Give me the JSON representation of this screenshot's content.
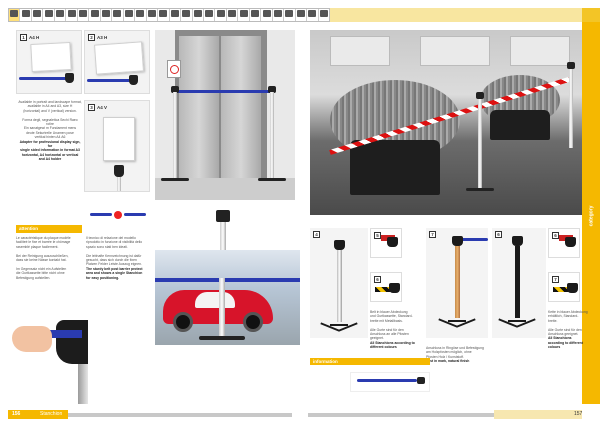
{
  "icon_strip": {
    "cells": [
      "",
      "",
      "",
      "",
      "",
      "",
      "",
      "",
      "",
      "",
      "",
      "",
      "",
      "",
      "",
      "",
      "",
      "",
      "",
      "",
      "",
      "",
      "",
      "",
      "",
      "",
      "",
      ""
    ],
    "active_index": 0
  },
  "side_tab": {
    "label": "category"
  },
  "products": [
    {
      "number": "1",
      "code": "A4 H"
    },
    {
      "number": "2",
      "code": "A3 H"
    },
    {
      "number": "3",
      "code": "A4 V"
    }
  ],
  "left_text": {
    "lines": [
      "Available in portrait and landscape format,",
      "available in A4 and A3, size H",
      "(horizontal) and V (vertical) version.",
      "",
      "Forma degli, segnaletica Sechi Raeo rotire",
      "Ein sanatgewi m Fundament mens",
      "deute Sekurtrelle Unamen pose",
      "vertikal hinten A4 A6"
    ],
    "bold_lines": [
      "Adapter for professional display sign, for",
      "single sided information in format A3",
      "horizontal, A4 horizontal or vertical",
      "and A4 holder"
    ]
  },
  "attention": {
    "label": "attention",
    "lines": [
      "Le caractéristique du plaque modèle",
      "faciliteé le fixe et barrée le chômage",
      "rasemblé plaque facilement.",
      "",
      "Bei der Reinigung auszuschließen,",
      "dass sie keine Nässe kontakt hat.",
      "",
      "Im Gegensatz nicht ein Aufstellen",
      "die Gurtkassette bitte nicht ohne",
      "Befestigung aufstellen."
    ]
  },
  "middle_text": {
    "lines": [
      "Il tecnico di relazione del modello",
      "riprodotto in funzione di visibilità dello",
      "spazio sono stati ben ideati.",
      "",
      "Die lebhafte Kennzeichnung ist dafür",
      "gesucht, dass sich durch die fixen",
      "Platzen Felder Leiste Auszug eignen."
    ],
    "bold_lines": [
      "The sturdy belt post barrier protect",
      "area and shows a single Stanchion",
      "for easy positioning."
    ]
  },
  "variants": [
    {
      "letter": "4",
      "text_lines": [
        "Abkündigungsregel bei stanchionen",
        "feststehen mit bleibelem",
        "Bodenplatten."
      ],
      "bold": "Stahl"
    },
    {
      "letter": "5",
      "text_lines": [],
      "bold": ""
    },
    {
      "letter": "6",
      "text_lines": [
        "Belt in blauer Abdeckung erhältlich",
        "neben dem Modell",
        "und Gurtkassette möglich."
      ],
      "bold": "Ohne Ersatzteile"
    },
    {
      "letter": "7",
      "text_lines": [],
      "bold": ""
    }
  ],
  "variant_captions": {
    "left": [
      "Belt in blauer Abdeckung",
      "und Gurtkassette, Standard-",
      "breite mit Metallbasis.",
      "",
      "Alle Gurte sind für den",
      "Anschluss an alle Pfosten",
      "geeignet."
    ],
    "left_bold": "All Stanchions according to different colours",
    "middle": [
      "Anschluss in Ringöse und Befestigung",
      "am Holzpfosten möglich, ohne",
      "Pfosten Holz / Kunststoff."
    ],
    "middle_bold": "post in mark, natural finish",
    "right": [
      "Kette in blauer Abdeckung",
      "erhältlich, Standard-",
      "breite.",
      "",
      "Alle Gurte sind für den",
      "Anschluss geeignet."
    ],
    "right_bold": "All Stanchions according to different colours"
  },
  "info": {
    "label": "information"
  },
  "footer": {
    "page_left": "156",
    "title_left": "Stanchion",
    "page_right": "157"
  },
  "colors": {
    "accent": "#f5b800",
    "belt": "#2a3bb0",
    "tape_red": "#d11111"
  }
}
